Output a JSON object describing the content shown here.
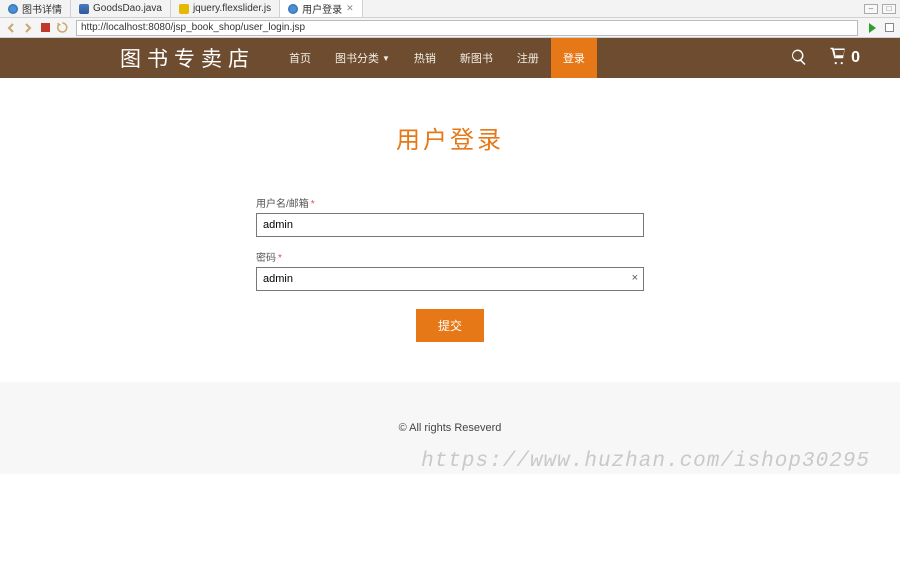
{
  "ide": {
    "tabs": [
      {
        "label": "图书详情",
        "icon": "world"
      },
      {
        "label": "GoodsDao.java",
        "icon": "java"
      },
      {
        "label": "jquery.flexslider.js",
        "icon": "js"
      },
      {
        "label": "用户登录",
        "icon": "world",
        "active": true,
        "close": "✕"
      }
    ],
    "url": "http://localhost:8080/jsp_book_shop/user_login.jsp"
  },
  "nav": {
    "brand": "图书专卖店",
    "items": [
      "首页",
      "图书分类",
      "热销",
      "新图书",
      "注册",
      "登录"
    ],
    "dropdown_index": 1,
    "active_index": 5,
    "cart_count": "0"
  },
  "login": {
    "title": "用户登录",
    "username_label": "用户名/邮箱",
    "password_label": "密码",
    "required": "*",
    "username_value": "admin",
    "password_value": "admin",
    "submit": "提交",
    "clear": "×"
  },
  "footer": {
    "text": "© All rights Reseverd"
  },
  "watermark": "https://www.huzhan.com/ishop30295"
}
